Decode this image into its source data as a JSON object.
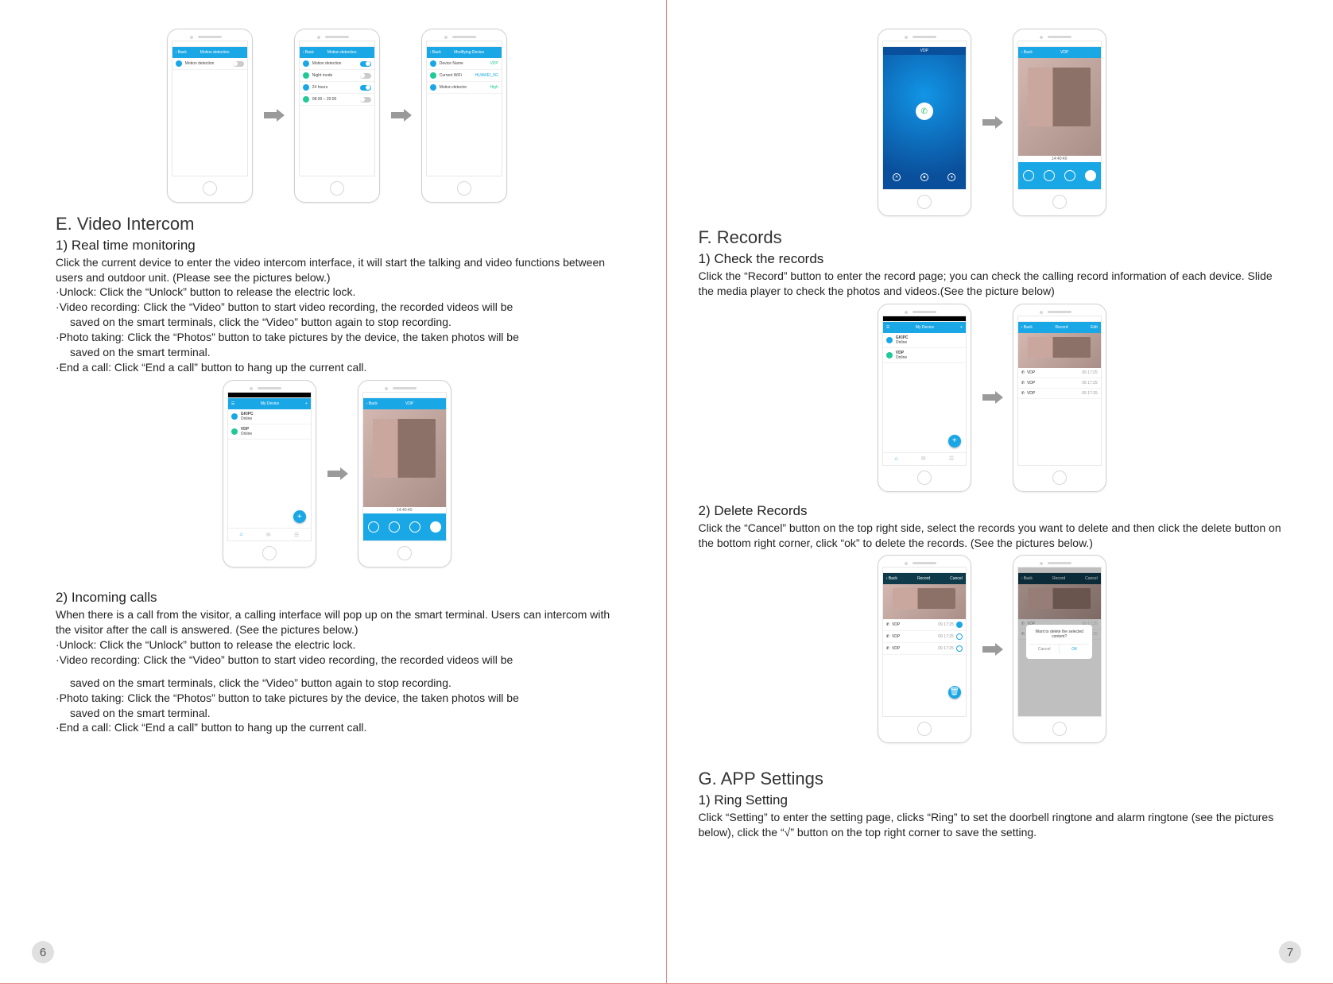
{
  "page_numbers": {
    "left": "6",
    "right": "7"
  },
  "icons": {
    "phone": "✆",
    "video": "■",
    "camera": "●",
    "plus": "+",
    "home": "⌂",
    "msg": "✉",
    "user": "☰"
  },
  "mock_labels": {
    "back": "‹ Back",
    "motion_detection": "Motion detection",
    "night_mode": "Night mode",
    "timer": "24 hours",
    "schedule": "08:00 – 20:00",
    "modifying_device": "Modifying Device",
    "device_name": "Device Name",
    "vdp": "VDP",
    "current_wifi": "Current WiFi",
    "wifi_value": "HUAWEI_5G",
    "motion_detector": "Motion detector",
    "high": "High",
    "my_device": "My Device",
    "gkipc": "GKIPC",
    "online": "Online",
    "record": "Record",
    "timestamp": "14:40:40",
    "rec_time": "09\n17:25",
    "delete_confirm": "Want to delete the selected content?",
    "cancel": "Cancel",
    "ok": "OK",
    "edit": "Edit"
  },
  "left": {
    "section_e": {
      "title": "E. Video Intercom",
      "sub1": {
        "title": "1) Real time monitoring",
        "p0": "Click the current device to enter the video intercom interface, it will start the talking and video functions between users and outdoor unit. (Please see the pictures below.)",
        "p1": "·Unlock: Click the “Unlock” button to release the electric lock.",
        "p2": "·Video recording: Click the “Video” button to start video recording, the recorded videos will be",
        "p2b": "saved on the smart terminals, click the “Video” button again to stop recording.",
        "p3": "·Photo taking: Click the “Photos” button to take pictures by the device, the taken photos will be",
        "p3b": "saved on the smart terminal.",
        "p4": "·End a call: Click “End a call” button to hang up the current call."
      },
      "sub2": {
        "title": "2) Incoming calls",
        "p0": "When there is a call from the visitor, a calling interface will pop up on the smart terminal. Users can intercom with the visitor after the call is answered. (See the pictures below.)",
        "p1": "·Unlock: Click the “Unlock” button to release the electric lock.",
        "p2": "·Video recording: Click the “Video” button to start video recording, the recorded videos will be",
        "p2gap": "saved on the smart terminals, click the “Video” button again to stop recording.",
        "p3": "·Photo taking: Click the “Photos” button to take pictures by the device, the taken photos will be",
        "p3b": "saved on the smart terminal.",
        "p4": "·End a call: Click “End a call” button to hang up the current call."
      }
    }
  },
  "right": {
    "section_f": {
      "title": "F. Records",
      "sub1": {
        "title": "1) Check the records",
        "p0": "Click the “Record” button to enter the record page; you can check the calling record information of each device. Slide the media player to check the photos and videos.(See the picture below)"
      },
      "sub2": {
        "title": "2) Delete Records",
        "p0": "Click the “Cancel” button on the top right side, select the records you want to delete and then click the delete button on the bottom right corner, click “ok” to delete the records. (See the pictures below.)"
      }
    },
    "section_g": {
      "title": "G. APP Settings",
      "sub1": {
        "title": "1) Ring Setting",
        "p0": "Click “Setting” to enter the setting page, clicks “Ring” to set the doorbell ringtone and alarm ringtone (see the pictures below), click the “√” button on the top right corner to save the setting."
      }
    }
  }
}
